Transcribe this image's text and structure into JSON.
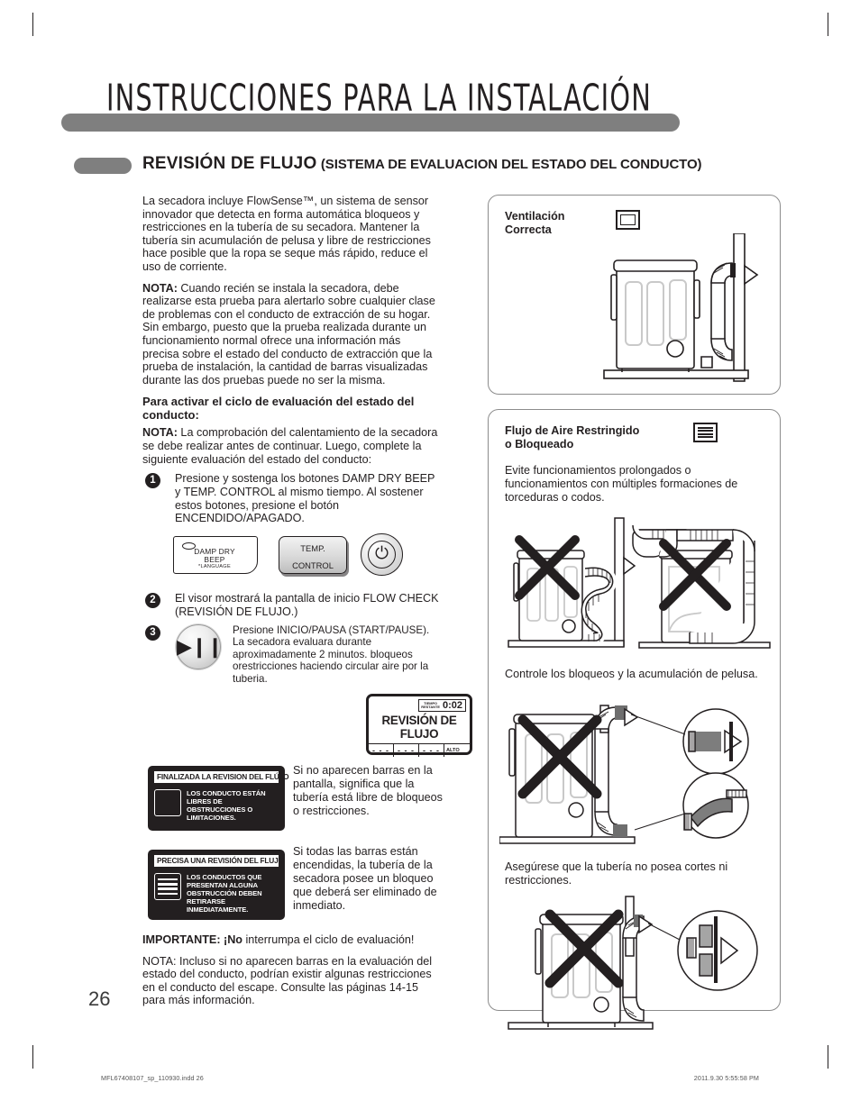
{
  "header": {
    "title": "INSTRUCCIONES PARA LA INSTALACIÓN",
    "section_title": "REVISIÓN DE FLUJO",
    "section_subtitle": "(SISTEMA DE EVALUACION DEL ESTADO DEL CONDUCTO)"
  },
  "left": {
    "intro": "La secadora incluye FlowSense™, un sistema de sensor innovador que detecta en forma automática bloqueos y restricciones en la tubería de su secadora. Mantener la tubería sin acumulación de pelusa y libre de restricciones hace posible que la ropa se seque más rápido, reduce el uso de corriente.",
    "note1_label": "NOTA:",
    "note1": " Cuando recién se instala la secadora, debe realizarse esta prueba para alertarlo sobre cualquier clase de problemas con el conducto de extracción de su hogar. Sin embargo, puesto que la prueba realizada durante un funcionamiento normal ofrece una información más precisa sobre el estado del conducto de extracción que la prueba de instalación, la cantidad de barras visualizadas durante las dos pruebas puede no ser la misma.",
    "subhead": "Para activar el ciclo de evaluación del estado del conducto:",
    "note2_label": "NOTA:",
    "note2": " La comprobación del calentamiento de la secadora se debe realizar antes de continuar. Luego, complete la siguiente evaluación del estado del conducto:",
    "steps": [
      {
        "num": "1",
        "text": "Presione y sostenga los botones DAMP DRY BEEP y TEMP. CONTROL al mismo tiempo. Al sostener estos botones, presione el botón ENCENDIDO/APAGADO."
      },
      {
        "num": "2",
        "text": "El visor mostrará la pantalla de inicio FLOW CHECK (REVISIÓN DE FLUJO.)"
      },
      {
        "num": "3",
        "text": "Presione INICIO/PAUSA (START/PAUSE). La secadora evaluara durante aproximadamente 2 minutos. bloqueos orestricciones haciendo circular aire por la tuberia."
      }
    ],
    "buttons": {
      "damp_dry_line1": "DAMP DRY",
      "damp_dry_line2": "BEEP",
      "damp_dry_line3": "*LANGUAGE",
      "temp_line1": "TEMP.",
      "temp_line2": "CONTROL",
      "power_icon": "power-icon",
      "start_pause_icon": "play-pause-icon"
    },
    "lcd": {
      "time_label_line1": "TIEMPO",
      "time_label_line2": "RESTANTE",
      "time_value": "0:02",
      "title": "REVISIÓN DE FLUJO",
      "bars": [
        "- - -",
        "- - -",
        "- - -"
      ],
      "level_label": "ALTO"
    },
    "box_ok": {
      "caption": "FINALIZADA LA REVISION DEL FLÚJO",
      "text": "LOS CONDUCTO ESTÁN LIBRES DE OBSTRUCCIONES O LIMITACIONES.",
      "indicator_bars": 0
    },
    "box_bad": {
      "caption": "PRECISA UNA REVISIÓN DEL FLUJO",
      "text": "LOS CONDUCTOS QUE PRESENTAN ALGUNA OBSTRUCCIÓN DEBEN RETIRARSE INMEDIATAMENTE.",
      "indicator_bars": 4
    },
    "box_ok_text": "Si no aparecen barras en la pantalla, significa que la tubería está libre de bloqueos o restricciones.",
    "box_bad_text": "Si todas las barras están encendidas, la tubería de la secadora posee un bloqueo que deberá ser eliminado de inmediato.",
    "important_label": "IMPORTANTE:",
    "important_bold2": " ¡No",
    "important_text": " interrumpa el ciclo de evaluación!",
    "final_note": "NOTA: Incluso si no aparecen barras en la evaluación del estado del conducto, podrían existir algunas restricciones en el conducto del escape. Consulte las páginas 14-15 para más información."
  },
  "right": {
    "panel_vent_title_line1": "Ventilación",
    "panel_vent_title_line2": "Correcta",
    "panel_vent_icon": "empty-bar-indicator-icon",
    "panel_block_title_line1": "Flujo de Aire Restringido",
    "panel_block_title_line2": "o Bloqueado",
    "panel_block_icon": "full-bar-indicator-icon",
    "panel_block_intro": "Evite funcionamientos prolongados o funcionamientos con múltiples formaciones de torceduras o codos.",
    "caption_lint": "Controle los bloqueos y la acumulación de pelusa.",
    "caption_cuts": "Asegúrese que la tubería no posea cortes ni restricciones."
  },
  "footer": {
    "page_number": "26",
    "file_info": "MFL67408107_sp_110930.indd   26",
    "timestamp": "2011.9.30   5:55:58 PM"
  },
  "colors": {
    "ink": "#231f20",
    "rule_gray": "#7f7f7f",
    "panel_border": "#8c8c8c"
  }
}
